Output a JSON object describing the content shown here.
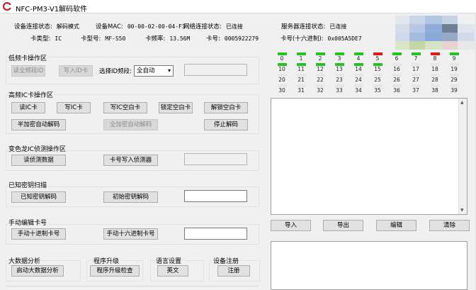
{
  "window": {
    "title": "NFC-PM3-V1解码软件"
  },
  "info": {
    "device_conn_label": "设备连接状态:",
    "device_conn_value": "解码模式",
    "mac_label": "设备MAC:",
    "mac_value": "00-00-02-00-04-F3",
    "net_conn_label": "网络连接状态:",
    "net_conn_value": "已连接",
    "server_conn_label": "服务器连接状态:",
    "server_conn_value": "已连接",
    "card_type_label": "卡类型:",
    "card_type_value": "IC",
    "card_model_label": "卡型号:",
    "card_model_value": "MF-S50",
    "freq_label": "卡频率:",
    "freq_value": "13.56M",
    "card_no_label": "卡号:",
    "card_no_value": "0005922279",
    "card_hex_label": "卡号(十六进制):",
    "card_hex_value": "0x005A5DE7"
  },
  "lf_section": {
    "title": "低频卡操作区",
    "read_id_btn": "读全频段ID",
    "write_id_btn": "写入ID卡",
    "select_label": "选择ID频段:",
    "select_value": "全自动"
  },
  "hf_section": {
    "title": "高频IC卡操作区",
    "read_ic": "读IC卡",
    "write_ic": "写IC卡",
    "write_blank_ic": "写IC空白卡",
    "lock_blank": "锁定空白卡",
    "unlock_blank": "解锁空白卡",
    "half_encrypted": "半加密自动解码",
    "full_encrypted": "全加密自动解码",
    "stop_decode": "停止解码"
  },
  "chameleon_section": {
    "title": "变色龙IC侦测操作区",
    "read_detect": "读侦测数据",
    "write_detector": "卡号写入侦测器"
  },
  "known_key_section": {
    "title": "已知密钥扫描",
    "known_key_decode": "已知密钥解码",
    "init_key_decode": "初始密钥解码"
  },
  "manual_section": {
    "title": "手动编辑卡号",
    "manual_dec": "手动十进制卡号",
    "manual_hex": "手动十六进制卡号"
  },
  "bottom_sections": {
    "bigdata_title": "大数据分析",
    "bigdata_btn": "启动大数据分析",
    "upgrade_title": "程序升级",
    "upgrade_btn": "程序升级检查",
    "lang_title": "语言设置",
    "lang_btn": "英文",
    "register_title": "设备注册",
    "register_btn": "注册"
  },
  "sectors": [
    {
      "n": "0",
      "c": "#22c422"
    },
    {
      "n": "1",
      "c": "#22c422"
    },
    {
      "n": "2",
      "c": "#22c422"
    },
    {
      "n": "3",
      "c": "#22c422"
    },
    {
      "n": "4",
      "c": "#22c422"
    },
    {
      "n": "5",
      "c": "#e01818"
    },
    {
      "n": "6",
      "c": "#22c422"
    },
    {
      "n": "7",
      "c": "#22c422"
    },
    {
      "n": "8",
      "c": "#e01818"
    },
    {
      "n": "9",
      "c": "#22c422"
    },
    {
      "n": "10",
      "c": "#22c422"
    },
    {
      "n": "11",
      "c": "#22c422"
    },
    {
      "n": "12",
      "c": "#22c422"
    },
    {
      "n": "13",
      "c": "#22c422"
    },
    {
      "n": "14",
      "c": "#22c422"
    },
    {
      "n": "15",
      "c": "#22c422"
    },
    {
      "n": "16",
      "c": "#e6e6e6"
    },
    {
      "n": "17",
      "c": "#e6e6e6"
    },
    {
      "n": "18",
      "c": "#e6e6e6"
    },
    {
      "n": "19",
      "c": "#e6e6e6"
    },
    {
      "n": "20",
      "c": "#e6e6e6"
    },
    {
      "n": "21",
      "c": "#e6e6e6"
    },
    {
      "n": "22",
      "c": "#e6e6e6"
    },
    {
      "n": "23",
      "c": "#e6e6e6"
    },
    {
      "n": "24",
      "c": "#e6e6e6"
    },
    {
      "n": "25",
      "c": "#e6e6e6"
    },
    {
      "n": "26",
      "c": "#e6e6e6"
    },
    {
      "n": "27",
      "c": "#e6e6e6"
    },
    {
      "n": "28",
      "c": "#e6e6e6"
    },
    {
      "n": "29",
      "c": "#e6e6e6"
    },
    {
      "n": "30",
      "c": "#e6e6e6"
    },
    {
      "n": "31",
      "c": "#e6e6e6"
    },
    {
      "n": "32",
      "c": "#e6e6e6"
    },
    {
      "n": "33",
      "c": "#e6e6e6"
    },
    {
      "n": "34",
      "c": "#e6e6e6"
    },
    {
      "n": "35",
      "c": "#e6e6e6"
    },
    {
      "n": "36",
      "c": "#e6e6e6"
    },
    {
      "n": "37",
      "c": "#e6e6e6"
    },
    {
      "n": "38",
      "c": "#e6e6e6"
    },
    {
      "n": "39",
      "c": "#e6e6e6"
    }
  ],
  "data_buttons": {
    "import": "导入",
    "export": "导出",
    "edit": "编辑",
    "clear": "清除"
  },
  "colors": {
    "active": "#22c422",
    "error": "#e01818",
    "idle": "#e6e6e6"
  }
}
